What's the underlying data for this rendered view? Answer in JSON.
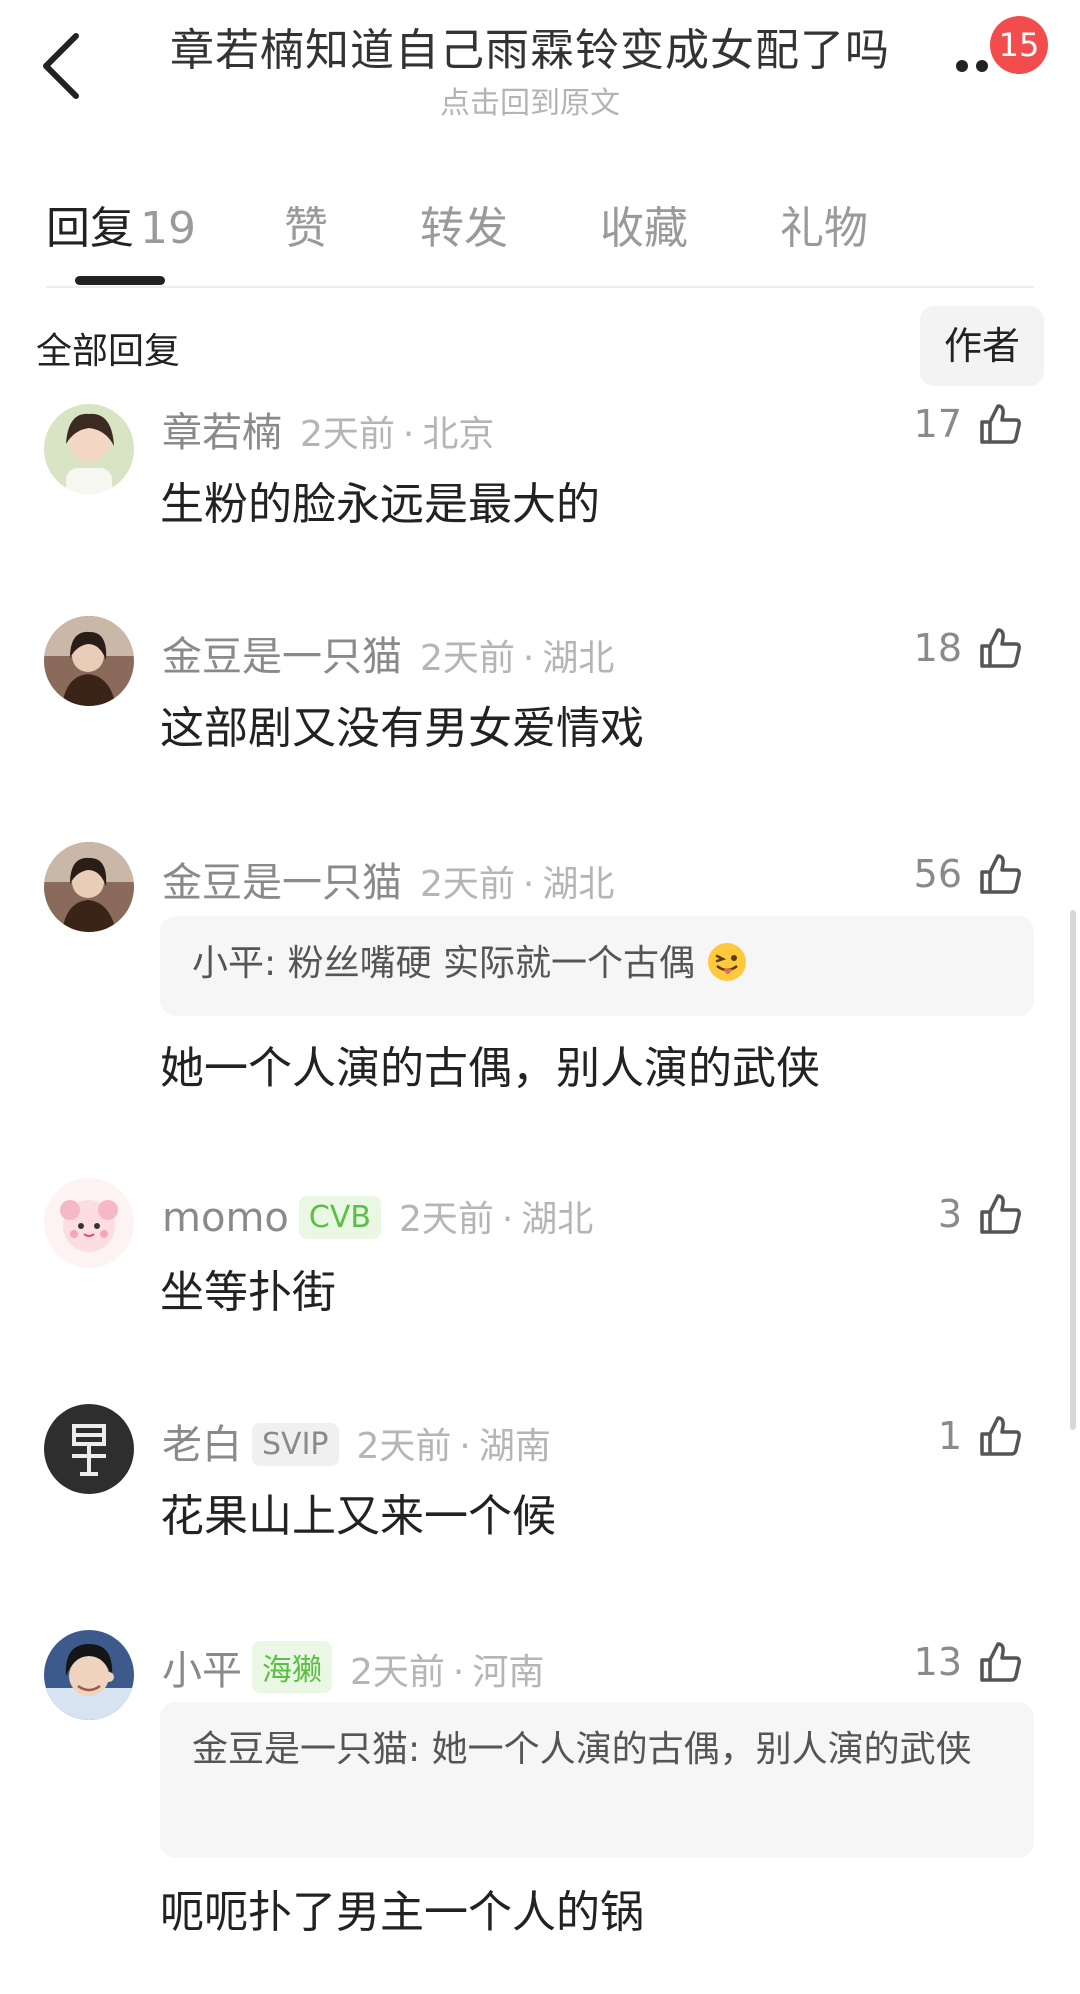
{
  "header": {
    "title": "章若楠知道自己雨霖铃变成女配了吗",
    "subtitle": "点击回到原文",
    "badge": "15"
  },
  "tabs": [
    {
      "label": "回复",
      "count": "19"
    },
    {
      "label": "赞"
    },
    {
      "label": "转发"
    },
    {
      "label": "收藏"
    },
    {
      "label": "礼物"
    }
  ],
  "filter": {
    "label": "全部回复",
    "author_button": "作者"
  },
  "comments": [
    {
      "user": "章若楠",
      "tag": "",
      "time": "2天前",
      "location": "北京",
      "likes": "17",
      "quote": "",
      "text": "生粉的脸永远是最大的"
    },
    {
      "user": "金豆是一只猫",
      "tag": "",
      "time": "2天前",
      "location": "湖北",
      "likes": "18",
      "quote": "",
      "text": "这部剧又没有男女爱情戏"
    },
    {
      "user": "金豆是一只猫",
      "tag": "",
      "time": "2天前",
      "location": "湖北",
      "likes": "56",
      "quote": "小平: 粉丝嘴硬 实际就一个古偶",
      "text": "她一个人演的古偶，别人演的武侠"
    },
    {
      "user": "momo",
      "tag": "CVB",
      "time": "2天前",
      "location": "湖北",
      "likes": "3",
      "quote": "",
      "text": "坐等扑街"
    },
    {
      "user": "老白",
      "tag": "SVIP",
      "time": "2天前",
      "location": "湖南",
      "likes": "1",
      "quote": "",
      "text": "花果山上又来一个候"
    },
    {
      "user": "小平",
      "tag": "海獭",
      "time": "2天前",
      "location": "河南",
      "likes": "13",
      "quote": "金豆是一只猫: 她一个人演的古偶，别人演的武侠",
      "text": "呃呃扑了男主一个人的锅"
    }
  ],
  "colors": {
    "badge": "#f24c4c",
    "tag_green": "#5bbf44",
    "username": "#8a8a8a",
    "meta": "#b5b5b5"
  }
}
